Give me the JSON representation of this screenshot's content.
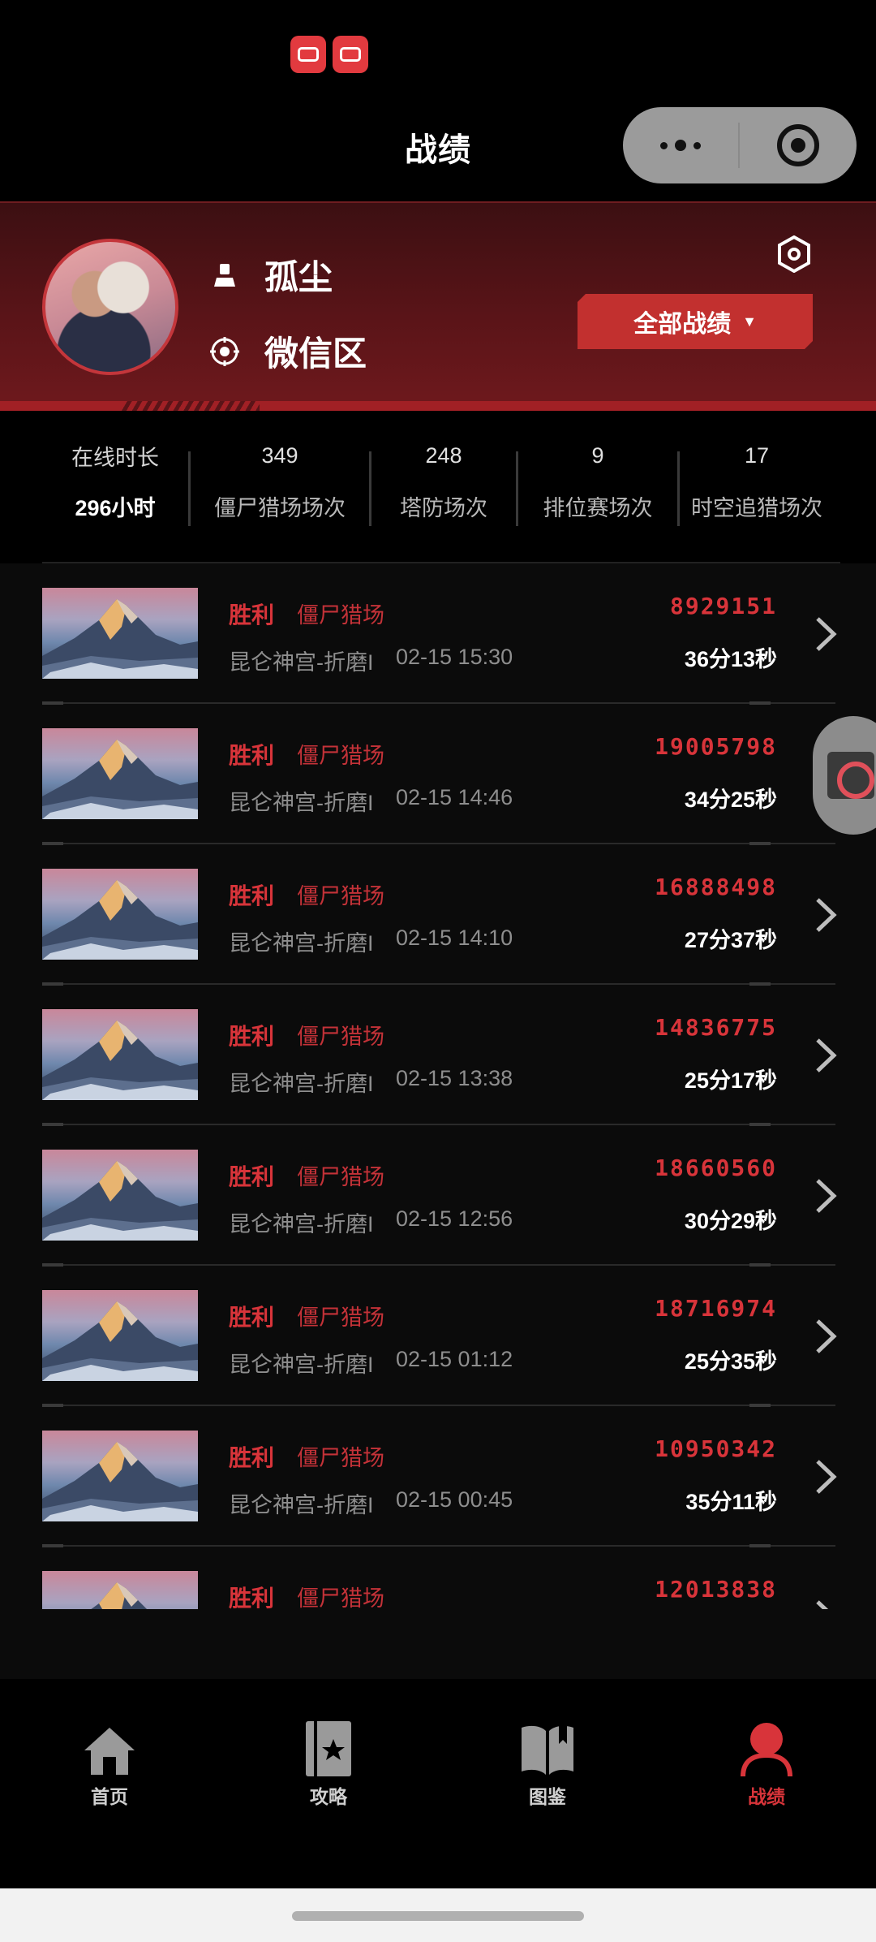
{
  "header": {
    "title": "战绩"
  },
  "profile": {
    "name": "孤尘",
    "region": "微信区",
    "filter_label": "全部战绩",
    "filter_caret": "▼"
  },
  "stats": [
    {
      "value": "在线时长",
      "label": "296小时"
    },
    {
      "value": "349",
      "label": "僵尸猎场场次"
    },
    {
      "value": "248",
      "label": "塔防场次"
    },
    {
      "value": "9",
      "label": "排位赛场次"
    },
    {
      "value": "17",
      "label": "时空追猎场次"
    }
  ],
  "records": [
    {
      "result": "胜利",
      "mode": "僵尸猎场",
      "map": "昆仑神宫-折磨I",
      "time": "02-15 15:30",
      "score": "8929151",
      "duration": "36分13秒"
    },
    {
      "result": "胜利",
      "mode": "僵尸猎场",
      "map": "昆仑神宫-折磨I",
      "time": "02-15 14:46",
      "score": "19005798",
      "duration": "34分25秒"
    },
    {
      "result": "胜利",
      "mode": "僵尸猎场",
      "map": "昆仑神宫-折磨I",
      "time": "02-15 14:10",
      "score": "16888498",
      "duration": "27分37秒"
    },
    {
      "result": "胜利",
      "mode": "僵尸猎场",
      "map": "昆仑神宫-折磨I",
      "time": "02-15 13:38",
      "score": "14836775",
      "duration": "25分17秒"
    },
    {
      "result": "胜利",
      "mode": "僵尸猎场",
      "map": "昆仑神宫-折磨I",
      "time": "02-15 12:56",
      "score": "18660560",
      "duration": "30分29秒"
    },
    {
      "result": "胜利",
      "mode": "僵尸猎场",
      "map": "昆仑神宫-折磨I",
      "time": "02-15 01:12",
      "score": "18716974",
      "duration": "25分35秒"
    },
    {
      "result": "胜利",
      "mode": "僵尸猎场",
      "map": "昆仑神宫-折磨I",
      "time": "02-15 00:45",
      "score": "10950342",
      "duration": "35分11秒"
    },
    {
      "result": "胜利",
      "mode": "僵尸猎场",
      "map": "",
      "time": "",
      "score": "12013838",
      "duration": ""
    }
  ],
  "tabs": [
    {
      "label": "首页",
      "icon": "home-icon",
      "active": false
    },
    {
      "label": "攻略",
      "icon": "guide-icon",
      "active": false
    },
    {
      "label": "图鉴",
      "icon": "book-icon",
      "active": false
    },
    {
      "label": "战绩",
      "icon": "profile-icon",
      "active": true
    }
  ],
  "colors": {
    "accent": "#d8343a",
    "background": "#0b0b0b",
    "header_red": "#5a1418"
  }
}
